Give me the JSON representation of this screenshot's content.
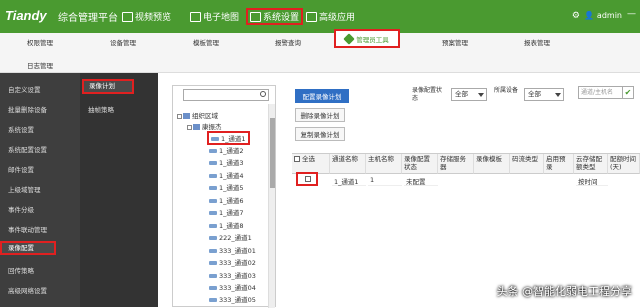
{
  "header": {
    "logo": "Tiandy",
    "brand": "综合管理平台",
    "nav": [
      {
        "label": "视频预览"
      },
      {
        "label": "电子地图"
      },
      {
        "label": "系统设置"
      },
      {
        "label": "高级应用"
      }
    ],
    "user": "admin"
  },
  "subnav": {
    "row1": [
      "权限管理",
      "设备管理",
      "模板管理",
      "报警查询",
      "管理员工具",
      "预案管理",
      "报表管理"
    ],
    "row2": [
      "日志管理"
    ]
  },
  "sidebar": {
    "items": [
      "自定义设置",
      "批量删除设备",
      "系统设置",
      "系统配置设置",
      "邮件设置",
      "上级域管理",
      "事件分级",
      "事件联动管理",
      "录像配置",
      "回传策略",
      "高级网络设置"
    ],
    "subitems": [
      "录像计划",
      "抽帧策略"
    ]
  },
  "tree": {
    "search_placeholder": "",
    "root": "组织区域",
    "group": "康振杰",
    "channels": [
      "1_通道1",
      "1_通道2",
      "1_通道3",
      "1_通道4",
      "1_通道5",
      "1_通道6",
      "1_通道7",
      "1_通道8",
      "222_通道1",
      "333_通道01",
      "333_通道02",
      "333_通道03",
      "333_通道04",
      "333_通道05"
    ]
  },
  "actions": {
    "configure": "配置录像计划",
    "delete": "删除录像计划",
    "copy": "复制录像计划"
  },
  "filters": {
    "status_label": "录像配置状态",
    "status_value": "全部",
    "device_label": "所属设备",
    "device_value": "全部",
    "search_placeholder": "通道/主机名"
  },
  "table": {
    "columns": [
      "全选",
      "通道名称",
      "主机名称",
      "录像配置状态",
      "存储服务器",
      "录像模板",
      "码流类型",
      "启用预录",
      "云存储配额类型",
      "配额时间(天)"
    ],
    "rows": [
      {
        "channel": "1_通道1",
        "host": "1",
        "status": "未配置",
        "quota_type": "按时间"
      }
    ]
  },
  "watermark": "头条 @智能化弱电工程分享"
}
